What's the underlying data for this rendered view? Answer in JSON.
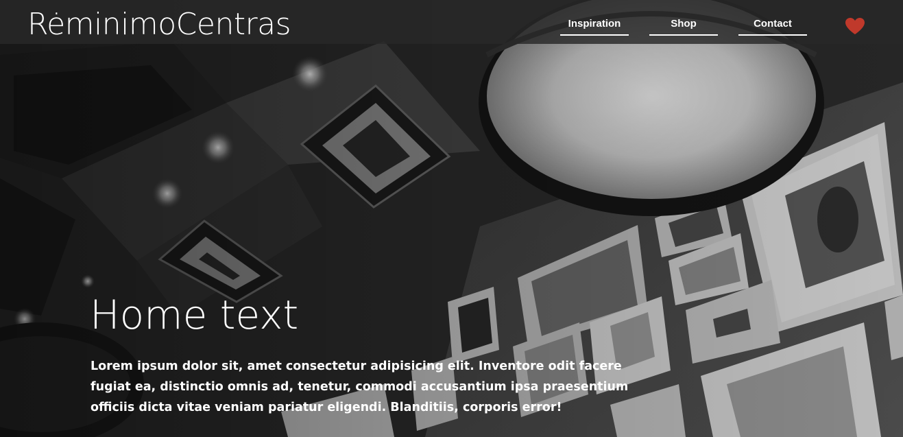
{
  "header": {
    "logo": "RėminimoCentras",
    "nav": {
      "inspiration": "Inspiration",
      "shop": "Shop",
      "contact": "Contact"
    },
    "favorites_icon": "heart-icon",
    "accent_color": "#c0392b"
  },
  "hero": {
    "title": "Home text",
    "body": "Lorem ipsum dolor sit, amet consectetur adipisicing elit. Inventore odit facere fugiat ea, distinctio omnis ad, tenetur, commodi accusantium ipsa praesentium officiis dicta vitae veniam pariatur eligendi. Blanditiis, corporis error!"
  }
}
